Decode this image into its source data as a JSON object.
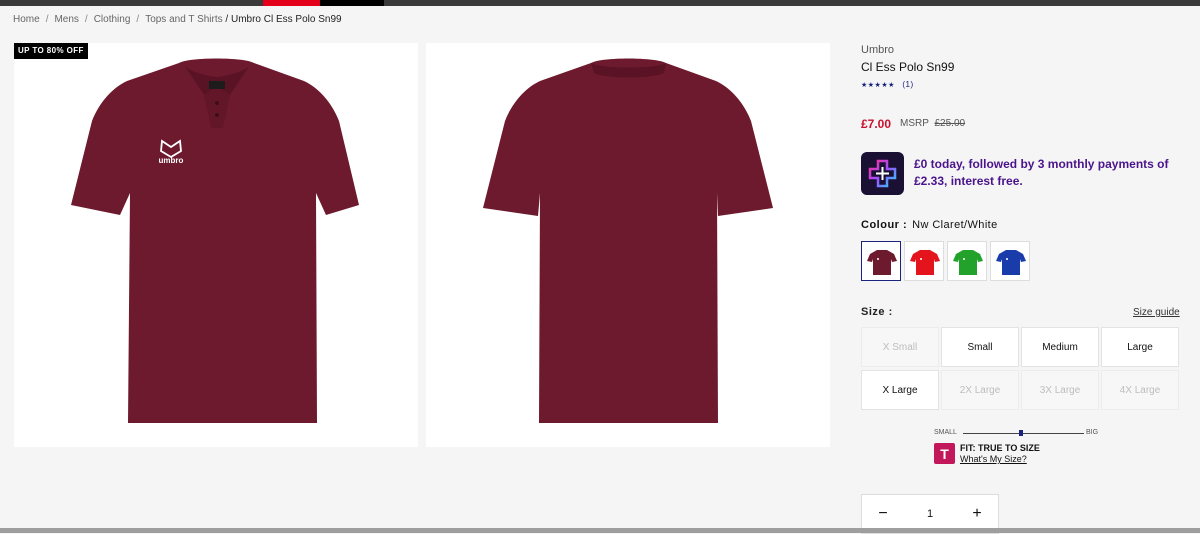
{
  "breadcrumb": {
    "items": [
      "Home",
      "Mens",
      "Clothing",
      "Tops and T Shirts"
    ],
    "separator": "/",
    "current": "/ Umbro Cl Ess Polo Sn99"
  },
  "gallery": {
    "badge": "UP TO 80% OFF",
    "images": [
      "front",
      "back"
    ]
  },
  "product": {
    "brand": "Umbro",
    "title": "Cl Ess Polo Sn99",
    "stars": "★★★★★",
    "review_count": "(1)",
    "price": "£7.00",
    "msrp_label": "MSRP",
    "msrp_value": "£25.00",
    "garment_color": "#6e1a2e",
    "logo_text": "umbro"
  },
  "bnpl": {
    "message": "£0 today, followed by 3 monthly payments of £2.33, interest free."
  },
  "colour": {
    "label": "Colour :",
    "selected": "Nw Claret/White",
    "swatches": [
      {
        "name": "claret",
        "color": "#6e1a2e",
        "selected": true
      },
      {
        "name": "red",
        "color": "#e3141b",
        "selected": false
      },
      {
        "name": "green",
        "color": "#22a22a",
        "selected": false
      },
      {
        "name": "royal-blue",
        "color": "#1a3caa",
        "selected": false
      }
    ]
  },
  "size": {
    "label": "Size :",
    "guide_label": "Size guide",
    "options": [
      {
        "label": "X Small",
        "available": false
      },
      {
        "label": "Small",
        "available": true
      },
      {
        "label": "Medium",
        "available": true
      },
      {
        "label": "Large",
        "available": true
      },
      {
        "label": "X Large",
        "available": true
      },
      {
        "label": "2X Large",
        "available": false
      },
      {
        "label": "3X Large",
        "available": false
      },
      {
        "label": "4X Large",
        "available": false
      }
    ]
  },
  "fit": {
    "small_label": "SMALL",
    "big_label": "BIG",
    "level": 0.48,
    "badge": "T",
    "text": "FIT: TRUE TO SIZE",
    "link": "What's My Size?"
  },
  "quantity": {
    "minus": "−",
    "value": "1",
    "plus": "+"
  }
}
